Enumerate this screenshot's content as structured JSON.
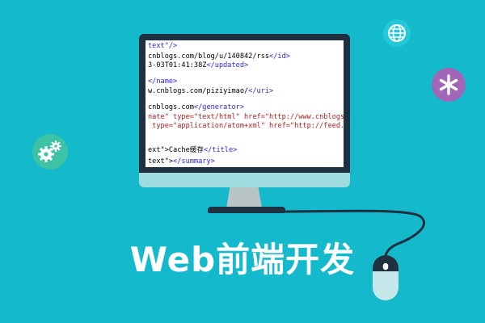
{
  "title": "Web前端开发",
  "code_lines": [
    {
      "pre": "",
      "tag": "text\"/>",
      "rest": ""
    },
    {
      "pre": "cnblogs.com/blog/u/140842/rss",
      "tag": "</id>",
      "rest": ""
    },
    {
      "pre": "3-03T01:41:38Z",
      "tag": "</updated>",
      "rest": ""
    },
    {
      "pre": "",
      "tag": "",
      "rest": ""
    },
    {
      "pre": "",
      "tag": "</name>",
      "rest": ""
    },
    {
      "pre": "w.cnblogs.com/piziyimao/",
      "tag": "</uri>",
      "rest": ""
    },
    {
      "pre": "",
      "tag": "",
      "rest": ""
    },
    {
      "pre": "cnblogs.com",
      "tag": "</generator>",
      "rest": ""
    },
    {
      "pre": "nate\" type=\"text/html\" href=\"http://www.cnblogs.",
      "tag": "",
      "rest": ""
    },
    {
      "pre": " type=\"application/atom+xml\" href=\"http://feed.c",
      "tag": "",
      "rest": ""
    },
    {
      "pre": "",
      "tag": "",
      "rest": ""
    },
    {
      "pre": "",
      "tag": "",
      "rest": ""
    },
    {
      "pre": "ext\">Cache缓存",
      "tag": "</title>",
      "rest": ""
    },
    {
      "pre": "text\">",
      "tag": "</summary>",
      "rest": ""
    }
  ],
  "icons": {
    "globe": "globe-icon",
    "asterisk": "asterisk-icon",
    "gears": "gears-icon",
    "mouse": "mouse-icon"
  },
  "colors": {
    "background": "#14b9cc",
    "monitor": "#1f3140",
    "title": "#ffffff",
    "tag": "#2a2ae0",
    "attr": "#b01f1f"
  }
}
